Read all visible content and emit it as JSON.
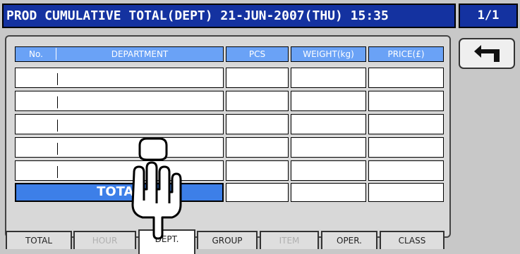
{
  "header": {
    "title": "PROD CUMULATIVE TOTAL(DEPT)  21-JUN-2007(THU) 15:35",
    "page": "1/1"
  },
  "table": {
    "columns": [
      "No.",
      "DEPARTMENT",
      "PCS",
      "WEIGHT(kg)",
      "PRICE(£)"
    ],
    "rows": [
      {
        "no": "",
        "department": "",
        "pcs": "",
        "weight": "",
        "price": ""
      },
      {
        "no": "",
        "department": "",
        "pcs": "",
        "weight": "",
        "price": ""
      },
      {
        "no": "",
        "department": "",
        "pcs": "",
        "weight": "",
        "price": ""
      },
      {
        "no": "",
        "department": "",
        "pcs": "",
        "weight": "",
        "price": ""
      },
      {
        "no": "",
        "department": "",
        "pcs": "",
        "weight": "",
        "price": ""
      }
    ],
    "total_label": "TOTAL"
  },
  "tabs": [
    "TOTAL",
    "HOUR",
    "DEPT.",
    "GROUP",
    "ITEM",
    "OPER.",
    "CLASS"
  ],
  "tab_state": {
    "active": "DEPT.",
    "disabled": [
      "HOUR",
      "ITEM"
    ]
  },
  "icons": {
    "back": "back-arrow-icon",
    "pointer": "pointing-hand-icon"
  },
  "colors": {
    "title_bg": "#1432a0",
    "header_cell": "#6aa2f6",
    "total_cell": "#3d7fe8"
  }
}
